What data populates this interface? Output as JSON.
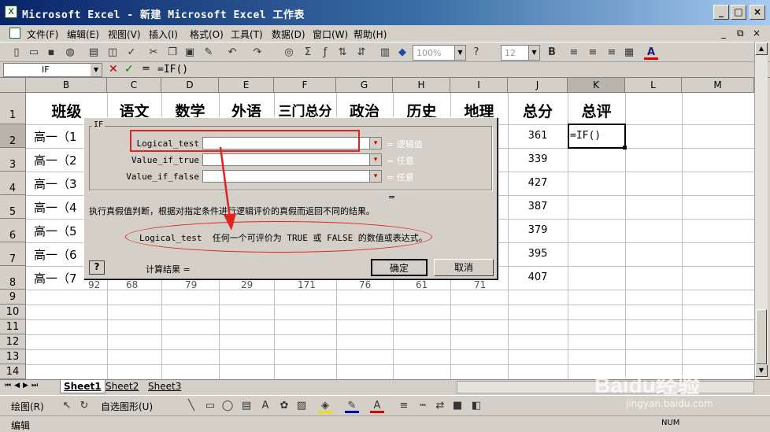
{
  "window": {
    "title": "Microsoft Excel - 新建 Microsoft Excel 工作表",
    "caption_buttons": [
      "_",
      "□",
      "×"
    ]
  },
  "menu": [
    "文件(F)",
    "编辑(E)",
    "视图(V)",
    "插入(I)",
    "格式(O)",
    "工具(T)",
    "数据(D)",
    "窗口(W)",
    "帮助(H)"
  ],
  "menu_right": [
    "_",
    "⧉",
    "×"
  ],
  "toolbar": {
    "zoom": "100%",
    "font_size": "12",
    "bold": "B",
    "font_color": "A"
  },
  "formula_bar": {
    "name_box": "IF",
    "cancel": "✕",
    "enter": "✓",
    "fx": "=",
    "content": "=IF()"
  },
  "columns": [
    "B",
    "C",
    "D",
    "E",
    "F",
    "G",
    "H",
    "I",
    "J",
    "K",
    "L",
    "M"
  ],
  "rows": [
    "1",
    "2",
    "3",
    "4",
    "5",
    "6",
    "7",
    "8",
    "9",
    "10",
    "11",
    "12",
    "13",
    "14"
  ],
  "headers": [
    "班级",
    "语文",
    "数学",
    "外语",
    "三门总分",
    "政治",
    "历史",
    "地理",
    "总分",
    "总评"
  ],
  "class_col": [
    "高一（1",
    "高一（2",
    "高一（3",
    "高一（4",
    "高一（5",
    "高一（6",
    "高一（7"
  ],
  "totals": [
    "361",
    "339",
    "427",
    "387",
    "379",
    "395",
    "407"
  ],
  "active_cell": "=IF()",
  "row8_partial": [
    "92",
    "68",
    "79",
    "29",
    "171",
    "76",
    "61",
    "71"
  ],
  "dialog": {
    "group_title": "IF",
    "args": [
      {
        "label": "Logical_test",
        "hint": "= 逻辑值"
      },
      {
        "label": "Value_if_true",
        "hint": "= 任意"
      },
      {
        "label": "Value_if_false",
        "hint": "= 任意"
      }
    ],
    "result_eq": "=",
    "description": "执行真假值判断，根据对指定条件进行逻辑评价的真假而返回不同的结果。",
    "arg_help": "Logical_test  任何一个可评价为 TRUE 或 FALSE 的数值或表达式。",
    "help_btn": "?",
    "calc_result": "计算结果 =",
    "ok": "确定",
    "cancel": "取消",
    "highlight_color": "#e02424"
  },
  "sheets": [
    "Sheet1",
    "Sheet2",
    "Sheet3"
  ],
  "drawing": {
    "draw": "绘图(R)",
    "autoshape": "自选图形(U)"
  },
  "status": {
    "mode": "编辑",
    "num": "NUM"
  },
  "watermark": {
    "brand": "Baidu经验",
    "url": "jingyan.baidu.com"
  }
}
